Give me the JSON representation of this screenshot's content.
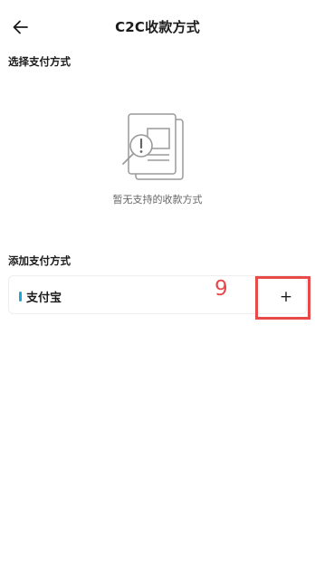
{
  "header": {
    "title": "C2C收款方式",
    "back_icon": "arrow-left-icon"
  },
  "select_section": {
    "title": "选择支付方式"
  },
  "empty_state": {
    "icon": "document-warning-search-icon",
    "text": "暂无支持的收款方式"
  },
  "add_section": {
    "title": "添加支付方式",
    "methods": [
      {
        "name": "支付宝",
        "add_label": "+",
        "accent_color": "#1aa7d6"
      }
    ]
  },
  "annotation": {
    "step_number": "9",
    "color": "#e84a4a"
  }
}
